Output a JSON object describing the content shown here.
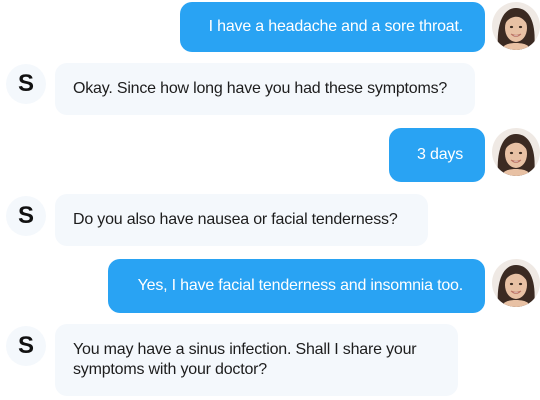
{
  "conversation": {
    "messages": [
      {
        "sender": "user",
        "text": "I have a headache and a sore throat."
      },
      {
        "sender": "bot",
        "mark": "S",
        "text": "Okay. Since how long have you had these symptoms?"
      },
      {
        "sender": "user",
        "text": "3 days"
      },
      {
        "sender": "bot",
        "mark": "S",
        "text": "Do you also have nausea or facial tenderness?"
      },
      {
        "sender": "user",
        "text": "Yes, I have facial tenderness and insomnia too."
      },
      {
        "sender": "bot",
        "mark": "S",
        "text": "You may have a sinus infection. Shall I share your symptoms with your doctor?"
      }
    ]
  },
  "colors": {
    "user_bubble": "#29a3f3",
    "bot_bubble": "#f4f8fc",
    "user_text": "#ffffff",
    "bot_text": "#1d1d1d"
  },
  "icons": {
    "user_avatar": "user-avatar-photo",
    "bot_avatar": "bot-letter-avatar"
  }
}
